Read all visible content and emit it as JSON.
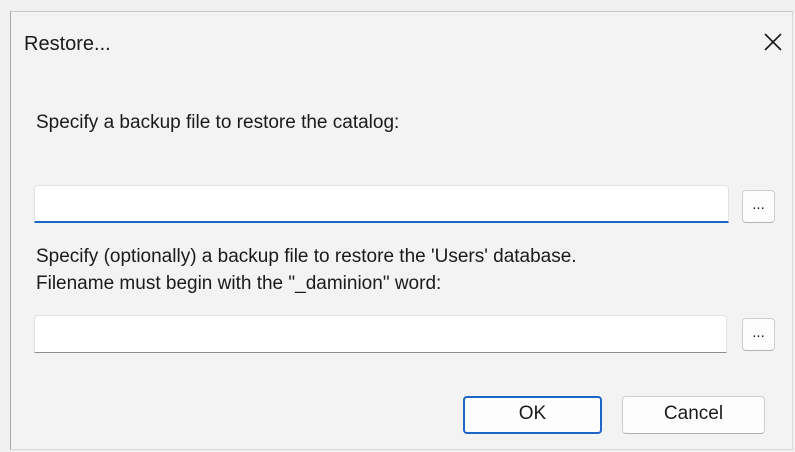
{
  "dialog": {
    "title": "Restore...",
    "close_icon": "close-icon"
  },
  "catalog": {
    "label": "Specify a backup file to restore the catalog:",
    "value": "",
    "browse_label": "..."
  },
  "users": {
    "label_line1": "Specify (optionally) a backup file to restore the 'Users' database.",
    "label_line2": "Filename must begin with the \"_daminion\" word:",
    "value": "",
    "browse_label": "..."
  },
  "buttons": {
    "ok_label": "OK",
    "cancel_label": "Cancel"
  },
  "colors": {
    "accent": "#1e66c5",
    "background": "#f3f3f3"
  }
}
